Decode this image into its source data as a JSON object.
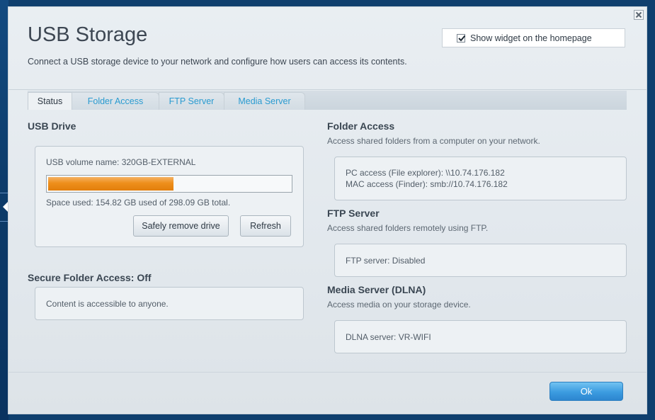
{
  "header": {
    "title": "USB Storage",
    "subtitle": "Connect a USB storage device to your network and configure how users can access its contents.",
    "show_widget_label": "Show widget on the homepage",
    "show_widget_checked": true
  },
  "tabs": [
    {
      "label": "Status",
      "active": true
    },
    {
      "label": "Folder Access",
      "active": false
    },
    {
      "label": "FTP Server",
      "active": false
    },
    {
      "label": "Media Server",
      "active": false
    }
  ],
  "usb_drive": {
    "title": "USB Drive",
    "volume_name": "USB volume name: 320GB-EXTERNAL",
    "usage_fraction": 0.519,
    "space_used_text": "Space used: 154.82 GB used of 298.09 GB total.",
    "safely_remove_label": "Safely remove drive",
    "refresh_label": "Refresh"
  },
  "secure_folder": {
    "title": "Secure Folder Access: Off",
    "content_text": "Content is accessible to anyone."
  },
  "folder_access": {
    "title": "Folder Access",
    "description": "Access shared folders from a computer on your network.",
    "pc_access": "PC access (File explorer): \\\\10.74.176.182",
    "mac_access": "MAC access (Finder): smb://10.74.176.182"
  },
  "ftp_server": {
    "title": "FTP Server",
    "description": "Access shared folders remotely using FTP.",
    "status": "FTP server: Disabled"
  },
  "media_server": {
    "title": "Media Server (DLNA)",
    "description": "Access media on your storage device.",
    "status": "DLNA server: VR-WIFI"
  },
  "footer": {
    "ok_label": "Ok"
  },
  "colors": {
    "accent": "#2a9bd0",
    "progress": "#ee8f1b",
    "ok_button": "#3b9be0",
    "background": "#0f3f6e"
  }
}
